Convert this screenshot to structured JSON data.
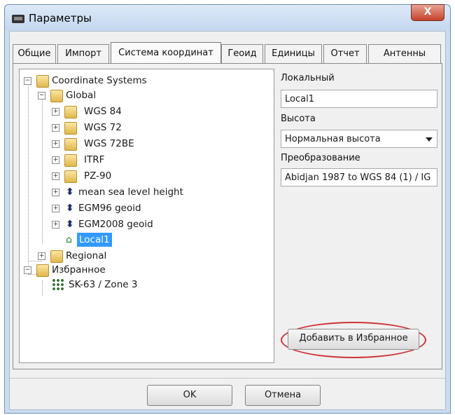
{
  "window": {
    "title": "Параметры",
    "close_label": "X"
  },
  "tabs": [
    "Общие",
    "Импорт",
    "Система координат",
    "Геоид",
    "Единицы",
    "Отчет",
    "Антенны"
  ],
  "tree": {
    "root": "Coordinate Systems",
    "global": "Global",
    "global_items": [
      "WGS 84",
      "WGS 72",
      "WGS 72BE",
      "ITRF",
      "PZ-90"
    ],
    "height_items": [
      "mean sea level height",
      "EGM96 geoid",
      "EGM2008 geoid"
    ],
    "local_selected": "Local1",
    "regional": "Regional",
    "favorites": "Избранное",
    "favorite_items": [
      "SK-63 / Zone 3"
    ]
  },
  "right_panel": {
    "local_label": "Локальный",
    "local_value": "Local1",
    "height_label": "Высота",
    "height_value": "Нормальная высота",
    "transform_label": "Преобразование",
    "transform_value": "Abidjan 1987 to WGS 84 (1) / IG",
    "add_favorite_label": "Добавить в Избранное"
  },
  "buttons": {
    "ok": "OK",
    "cancel": "Отмена"
  },
  "colors": {
    "selection": "#3399ff",
    "highlight_oval": "#d0333a"
  },
  "icons": {
    "folder": "folder-icon",
    "height": "up-down-arrow-icon",
    "local": "home-icon",
    "favorite": "grid-icon"
  }
}
